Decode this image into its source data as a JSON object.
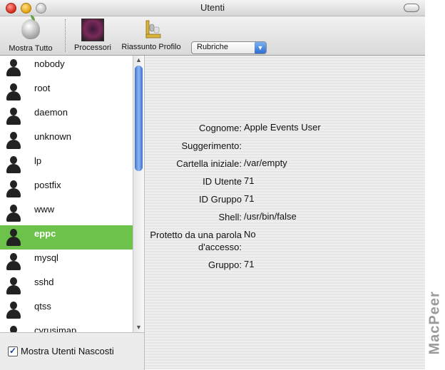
{
  "window": {
    "title": "Utenti"
  },
  "toolbar": {
    "items": [
      {
        "label": "Mostra Tutto",
        "icon": "apple-icon"
      },
      {
        "label": "Processori",
        "icon": "processor-icon"
      },
      {
        "label": "Riassunto Profilo",
        "icon": "profile-summary-icon"
      }
    ],
    "popup": {
      "value": "Rubriche"
    }
  },
  "users": [
    {
      "name": "nobody",
      "selected": false
    },
    {
      "name": "root",
      "selected": false
    },
    {
      "name": "daemon",
      "selected": false
    },
    {
      "name": "unknown",
      "selected": false
    },
    {
      "name": "lp",
      "selected": false
    },
    {
      "name": "postfix",
      "selected": false
    },
    {
      "name": "www",
      "selected": false
    },
    {
      "name": "eppc",
      "selected": true
    },
    {
      "name": "mysql",
      "selected": false
    },
    {
      "name": "sshd",
      "selected": false
    },
    {
      "name": "qtss",
      "selected": false
    },
    {
      "name": "cyrusimap",
      "selected": false
    }
  ],
  "show_hidden": {
    "label": "Mostra Utenti Nascosti",
    "checked": true
  },
  "details": [
    {
      "label": "Cognome:",
      "value": "Apple Events User"
    },
    {
      "label": "Suggerimento:",
      "value": ""
    },
    {
      "label": "Cartella iniziale:",
      "value": "/var/empty"
    },
    {
      "label": "ID Utente",
      "value": "71"
    },
    {
      "label": "ID Gruppo",
      "value": "71"
    },
    {
      "label": "Shell:",
      "value": "/usr/bin/false"
    },
    {
      "label": "Protetto da una parola d'accesso:",
      "value": "No"
    },
    {
      "label": "Gruppo:",
      "value": "71"
    }
  ],
  "watermark": "MacPeer",
  "colors": {
    "selection": "#6cc24a",
    "scroll_thumb": "#3a6fcf"
  }
}
